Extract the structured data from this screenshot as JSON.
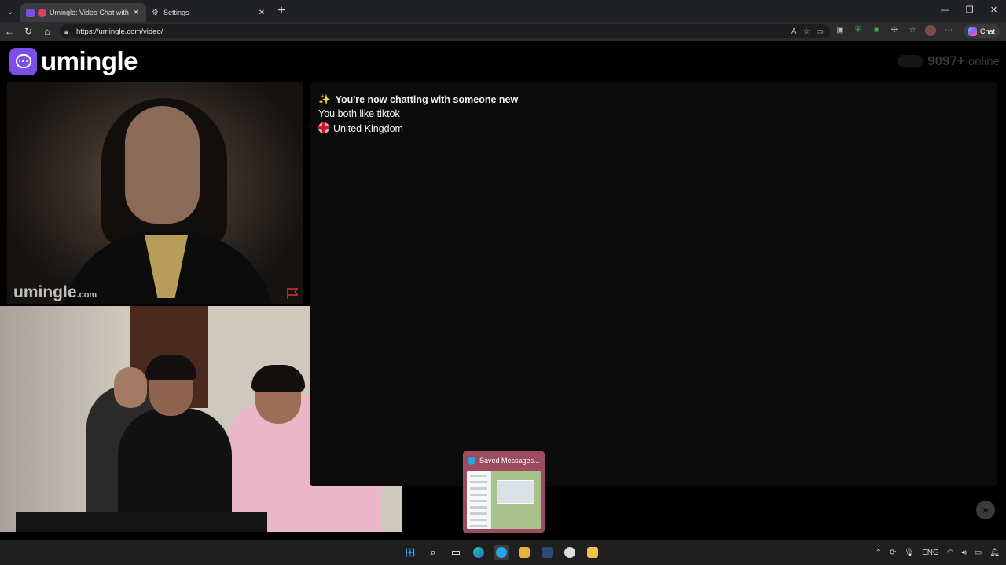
{
  "browser": {
    "tabs": [
      {
        "title": "Umingle: Video Chat with Str",
        "active": true
      },
      {
        "title": "Settings",
        "active": false
      }
    ],
    "url": "https://umingle.com/video/",
    "copilot_label": "Chat"
  },
  "site": {
    "logo_text": "umingle",
    "online_count": "9097+",
    "online_label": "online"
  },
  "stranger_video": {
    "watermark": "umingle",
    "watermark_suffix": ".com"
  },
  "chat": {
    "intro": "You're now chatting with someone new",
    "interests": "You both like tiktok",
    "country": "United Kingdom"
  },
  "taskbar_preview": {
    "title": "Saved Messages..."
  },
  "tray": {
    "language": "ENG"
  },
  "colors": {
    "brand": "#7b4fe3",
    "background": "#000000",
    "chat_panel": "#0b0b0b"
  }
}
